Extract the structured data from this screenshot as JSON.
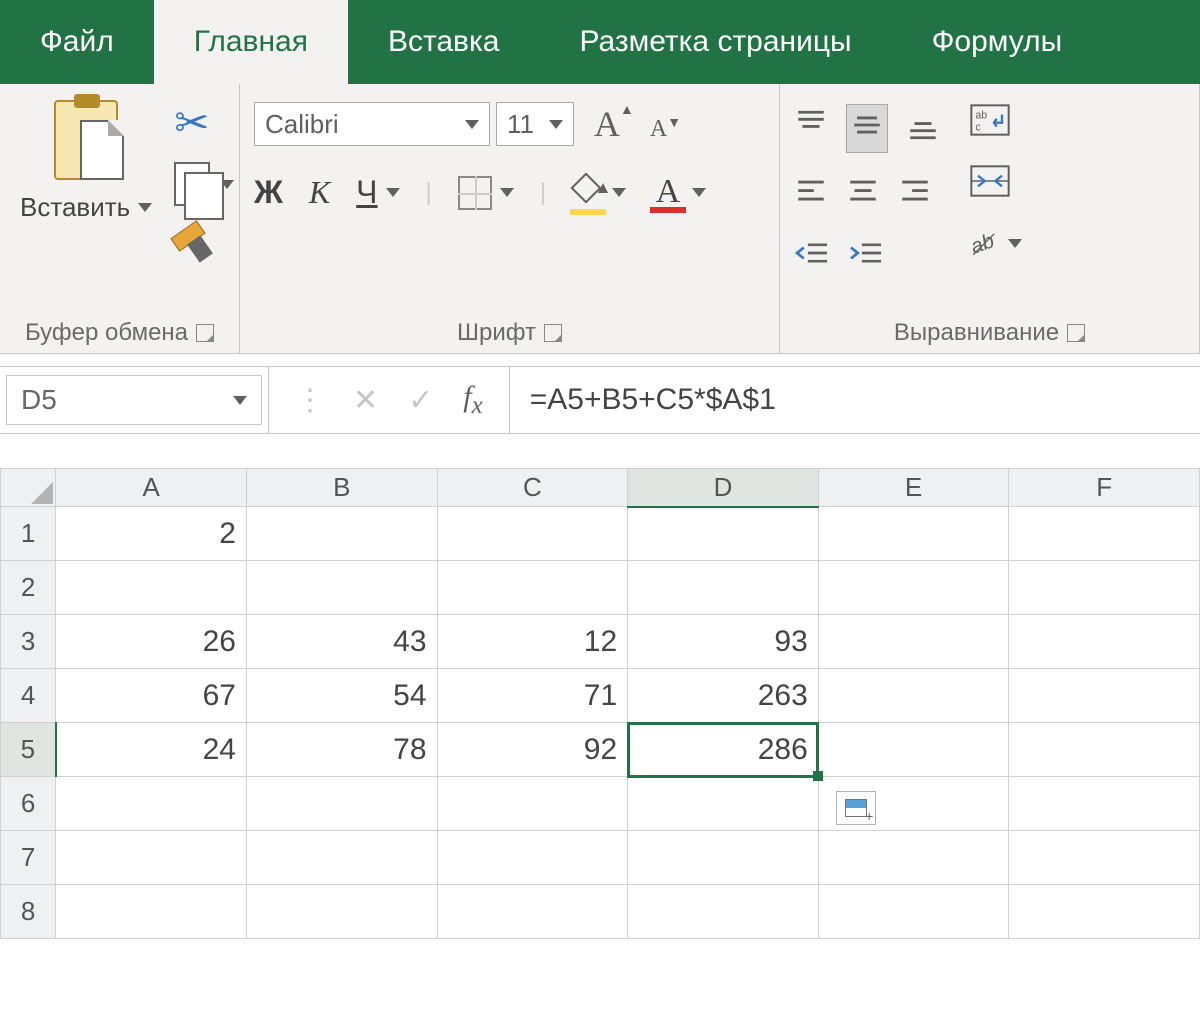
{
  "tabs": {
    "file": "Файл",
    "home": "Главная",
    "insert": "Вставка",
    "page_layout": "Разметка страницы",
    "formulas": "Формулы"
  },
  "ribbon": {
    "clipboard": {
      "paste": "Вставить",
      "label": "Буфер обмена"
    },
    "font": {
      "name": "Calibri",
      "size": "11",
      "bold": "Ж",
      "italic": "К",
      "underline": "Ч",
      "font_color_glyph": "А",
      "label": "Шрифт"
    },
    "alignment": {
      "label": "Выравнивание"
    }
  },
  "formula_bar": {
    "name_box": "D5",
    "formula": "=A5+B5+C5*$A$1"
  },
  "grid": {
    "columns": [
      "A",
      "B",
      "C",
      "D",
      "E",
      "F"
    ],
    "rows": [
      "1",
      "2",
      "3",
      "4",
      "5",
      "6",
      "7",
      "8"
    ],
    "active_col": "D",
    "active_row": "5",
    "cells": {
      "A1": "2",
      "A3": "26",
      "B3": "43",
      "C3": "12",
      "D3": "93",
      "A4": "67",
      "B4": "54",
      "C4": "71",
      "D4": "263",
      "A5": "24",
      "B5": "78",
      "C5": "92",
      "D5": "286"
    }
  }
}
